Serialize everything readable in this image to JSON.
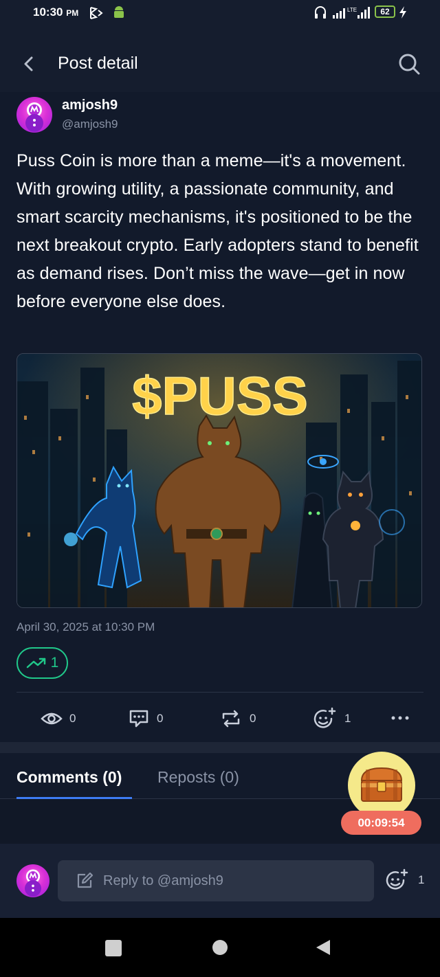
{
  "status_bar": {
    "time": "10:30",
    "ampm": "PM",
    "network": "LTE",
    "battery": "62"
  },
  "header": {
    "title": "Post detail",
    "back_icon": "chevron-left-icon",
    "search_icon": "search-icon"
  },
  "post": {
    "author_name": "amjosh9",
    "author_handle": "@amjosh9",
    "text": "Puss Coin is more than a meme—it's a movement. With growing utility, a passionate community, and smart scarcity mechanisms, it's positioned to be the next breakout crypto. Early adopters stand to benefit as demand rises. Don’t miss the wave—get in now before everyone else does.",
    "image_headline": "$PUSS",
    "date": "April 30, 2025 at 10:30 PM",
    "trend_count": "1",
    "stats": {
      "views": "0",
      "comments": "0",
      "reposts": "0",
      "reactions": "1"
    }
  },
  "tabs": {
    "comments": "Comments (0)",
    "reposts": "Reposts (0)"
  },
  "reward": {
    "timer": "00:09:54"
  },
  "reply": {
    "placeholder": "Reply to @amjosh9",
    "reaction_count": "1"
  },
  "colors": {
    "background": "#121a2b",
    "accent_green": "#20c88a",
    "accent_blue": "#3d7cf5",
    "timer_red": "#ef6d5e"
  }
}
